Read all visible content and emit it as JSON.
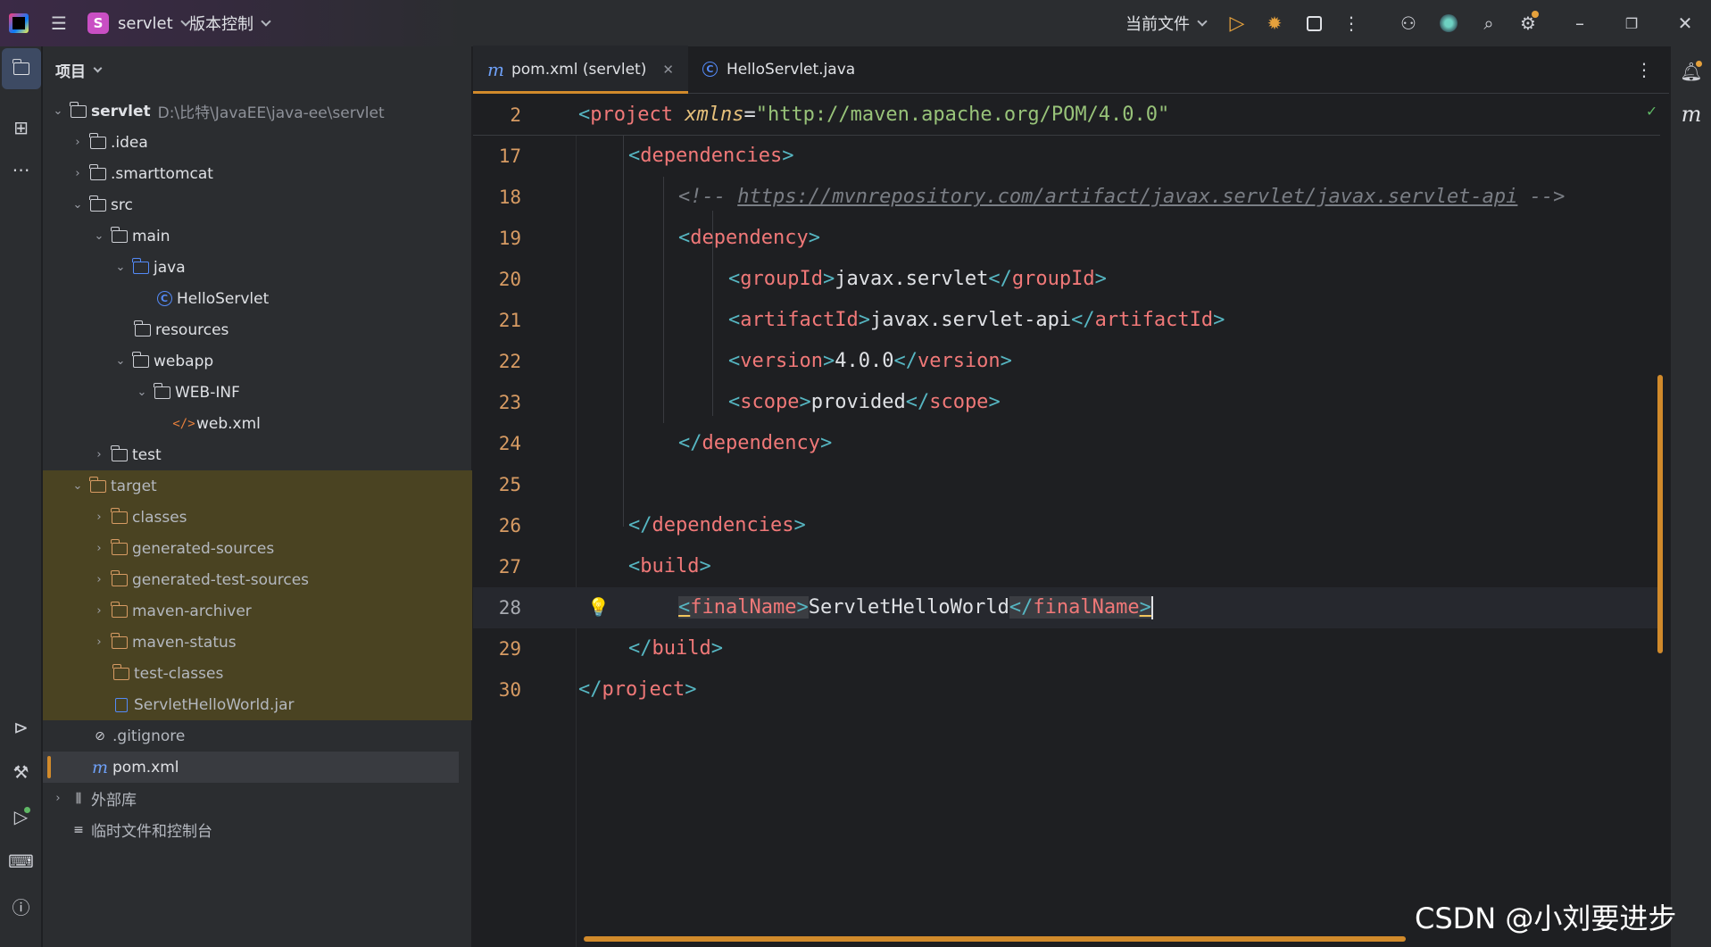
{
  "titlebar": {
    "project_badge": "S",
    "project_name": "servlet",
    "vcs_label": "版本控制",
    "run_config": "当前文件",
    "icons": [
      "app-logo-icon",
      "hamburger-menu-icon",
      "run-icon",
      "debug-icon",
      "stop-icon",
      "more-icon",
      "add-user-icon",
      "ai-assistant-icon",
      "search-icon",
      "settings-icon",
      "minimize-icon",
      "restore-icon",
      "close-icon"
    ]
  },
  "left_strip": {
    "icons": [
      "project-folder-icon",
      "structure-icon",
      "more-tools-icon",
      "services-icon",
      "build-icon",
      "run-icon",
      "terminal-icon",
      "problems-icon"
    ]
  },
  "project_panel": {
    "title": "项目",
    "tree": [
      {
        "label": "servlet",
        "extra": "D:\\比特\\JavaEE\\java-ee\\servlet",
        "depth": 0,
        "arrow": "down",
        "kind": "module"
      },
      {
        "label": ".idea",
        "depth": 1,
        "arrow": "right",
        "kind": "folder"
      },
      {
        "label": ".smarttomcat",
        "depth": 1,
        "arrow": "right",
        "kind": "folder"
      },
      {
        "label": "src",
        "depth": 1,
        "arrow": "down",
        "kind": "folder"
      },
      {
        "label": "main",
        "depth": 2,
        "arrow": "down",
        "kind": "folder"
      },
      {
        "label": "java",
        "depth": 3,
        "arrow": "down",
        "kind": "src-folder"
      },
      {
        "label": "HelloServlet",
        "depth": 5,
        "arrow": "",
        "kind": "class"
      },
      {
        "label": "resources",
        "depth": 4,
        "arrow": "",
        "kind": "res-folder"
      },
      {
        "label": "webapp",
        "depth": 3,
        "arrow": "down",
        "kind": "folder"
      },
      {
        "label": "WEB-INF",
        "depth": 4,
        "arrow": "down",
        "kind": "folder"
      },
      {
        "label": "web.xml",
        "depth": 6,
        "arrow": "",
        "kind": "xml"
      },
      {
        "label": "test",
        "depth": 2,
        "arrow": "right",
        "kind": "folder"
      },
      {
        "label": "target",
        "depth": 1,
        "arrow": "down",
        "kind": "excluded"
      },
      {
        "label": "classes",
        "depth": 2,
        "arrow": "right",
        "kind": "excluded"
      },
      {
        "label": "generated-sources",
        "depth": 2,
        "arrow": "right",
        "kind": "excluded"
      },
      {
        "label": "generated-test-sources",
        "depth": 2,
        "arrow": "right",
        "kind": "excluded"
      },
      {
        "label": "maven-archiver",
        "depth": 2,
        "arrow": "right",
        "kind": "excluded"
      },
      {
        "label": "maven-status",
        "depth": 2,
        "arrow": "right",
        "kind": "excluded"
      },
      {
        "label": "test-classes",
        "depth": 3,
        "arrow": "",
        "kind": "excluded"
      },
      {
        "label": "ServletHelloWorld.jar",
        "depth": 3,
        "arrow": "",
        "kind": "jar"
      },
      {
        "label": ".gitignore",
        "depth": 2,
        "arrow": "",
        "kind": "ignore"
      },
      {
        "label": "pom.xml",
        "depth": 2,
        "arrow": "",
        "kind": "maven"
      },
      {
        "label": "外部库",
        "depth": 0,
        "arrow": "right",
        "kind": "lib"
      },
      {
        "label": "临时文件和控制台",
        "depth": 0,
        "arrow": "",
        "kind": "scratch"
      }
    ]
  },
  "editor": {
    "tabs": [
      {
        "icon": "m",
        "label": "pom.xml (servlet)",
        "active": true
      },
      {
        "icon": "C",
        "label": "HelloServlet.java",
        "active": false
      }
    ],
    "lines": [
      {
        "n": "2",
        "text": "<project xmlns=\"http://maven.apache.org/POM/4.0.0\""
      },
      {
        "n": "17",
        "text": "<dependencies>"
      },
      {
        "n": "18",
        "text": "<!-- https://mvnrepository.com/artifact/javax.servlet/javax.servlet-api -->"
      },
      {
        "n": "19",
        "text": "<dependency>"
      },
      {
        "n": "20",
        "text": "<groupId>javax.servlet</groupId>"
      },
      {
        "n": "21",
        "text": "<artifactId>javax.servlet-api</artifactId>"
      },
      {
        "n": "22",
        "text": "<version>4.0.0</version>"
      },
      {
        "n": "23",
        "text": "<scope>provided</scope>"
      },
      {
        "n": "24",
        "text": "</dependency>"
      },
      {
        "n": "25",
        "text": ""
      },
      {
        "n": "26",
        "text": "</dependencies>"
      },
      {
        "n": "27",
        "text": "<build>"
      },
      {
        "n": "28",
        "text": "<finalName>ServletHelloWorld</finalName>"
      },
      {
        "n": "29",
        "text": "</build>"
      },
      {
        "n": "30",
        "text": "</project>"
      }
    ],
    "tokens": {
      "project": "project",
      "xmlns_attr": "xmlns",
      "xmlns_val": "\"http://maven.apache.org/POM/4.0.0\"",
      "dependencies": "dependencies",
      "comment_open": "<!-- ",
      "comment_url": "https://mvnrepository.com/artifact/javax.servlet/javax.servlet-api",
      "comment_close": " -->",
      "dependency": "dependency",
      "groupId": "groupId",
      "groupId_val": "javax.servlet",
      "artifactId": "artifactId",
      "artifactId_val": "javax.servlet-api",
      "version": "version",
      "version_val": "4.0.0",
      "scope": "scope",
      "scope_val": "provided",
      "build": "build",
      "finalName": "finalName",
      "finalName_val": "ServletHelloWorld"
    }
  },
  "right_strip": {
    "icons": [
      "notifications-icon",
      "maven-icon"
    ],
    "maven_label": "m"
  },
  "watermark": "CSDN @小刘要进步",
  "colors": {
    "accent": "#d18a2b",
    "tag": "#f07878",
    "bracket": "#56b6c2",
    "attr": "#e6c07b",
    "string": "#98c379"
  }
}
